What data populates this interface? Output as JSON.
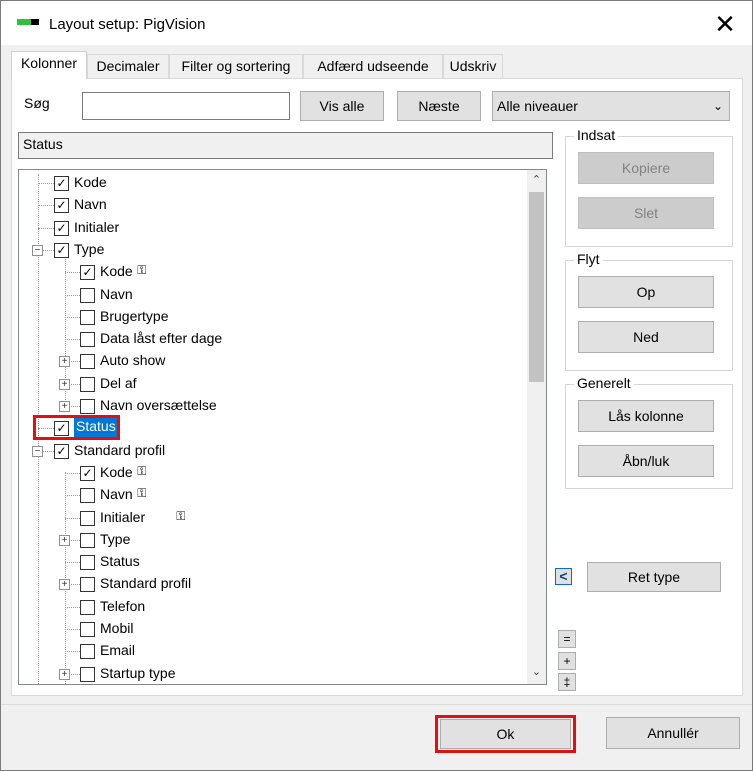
{
  "window": {
    "title": "Layout setup: PigVision",
    "close_glyph": "✕"
  },
  "tabs": [
    {
      "label": "Kolonner",
      "active": true
    },
    {
      "label": "Decimaler",
      "active": false
    },
    {
      "label": "Filter og sortering",
      "active": false
    },
    {
      "label": "Adfærd  udseende",
      "active": false
    },
    {
      "label": "Udskriv",
      "active": false
    }
  ],
  "search": {
    "label": "Søg",
    "value": "",
    "show_all": "Vis alle",
    "next": "Næste",
    "level_select": "Alle niveauer"
  },
  "status_field": "Status",
  "tree": [
    {
      "label": "Kode",
      "checked": true
    },
    {
      "label": "Navn",
      "checked": true
    },
    {
      "label": "Initialer",
      "checked": true
    },
    {
      "label": "Type",
      "checked": true
    },
    {
      "label": "Kode",
      "checked": true
    },
    {
      "label": "Navn",
      "checked": false
    },
    {
      "label": "Brugertype",
      "checked": false
    },
    {
      "label": "Data låst efter dage",
      "checked": false
    },
    {
      "label": "Auto show",
      "checked": false
    },
    {
      "label": "Del af",
      "checked": false
    },
    {
      "label": "Navn oversættelse",
      "checked": false
    },
    {
      "label": "Status",
      "checked": true
    },
    {
      "label": "Standard profil",
      "checked": true
    },
    {
      "label": "Kode",
      "checked": true
    },
    {
      "label": "Navn",
      "checked": false
    },
    {
      "label": "Initialer",
      "checked": false
    },
    {
      "label": "Type",
      "checked": false
    },
    {
      "label": "Status",
      "checked": false
    },
    {
      "label": "Standard profil",
      "checked": false
    },
    {
      "label": "Telefon",
      "checked": false
    },
    {
      "label": "Mobil",
      "checked": false
    },
    {
      "label": "Email",
      "checked": false
    },
    {
      "label": "Startup type",
      "checked": false
    }
  ],
  "groups": {
    "insert": {
      "title": "Indsat",
      "copy": "Kopiere",
      "delete": "Slet"
    },
    "move": {
      "title": "Flyt",
      "up": "Op",
      "down": "Ned"
    },
    "general": {
      "title": "Generelt",
      "lock": "Lås kolonne",
      "open_close": "Åbn/luk"
    }
  },
  "ret_type": {
    "arrow": "<",
    "label": "Ret type"
  },
  "tree_controls": {
    "collapse": "=",
    "expand": "+",
    "toggle": "‡"
  },
  "footer": {
    "ok": "Ok",
    "cancel": "Annullér"
  },
  "colors": {
    "selection": "#0078d7",
    "highlight_frame": "#e01010"
  }
}
